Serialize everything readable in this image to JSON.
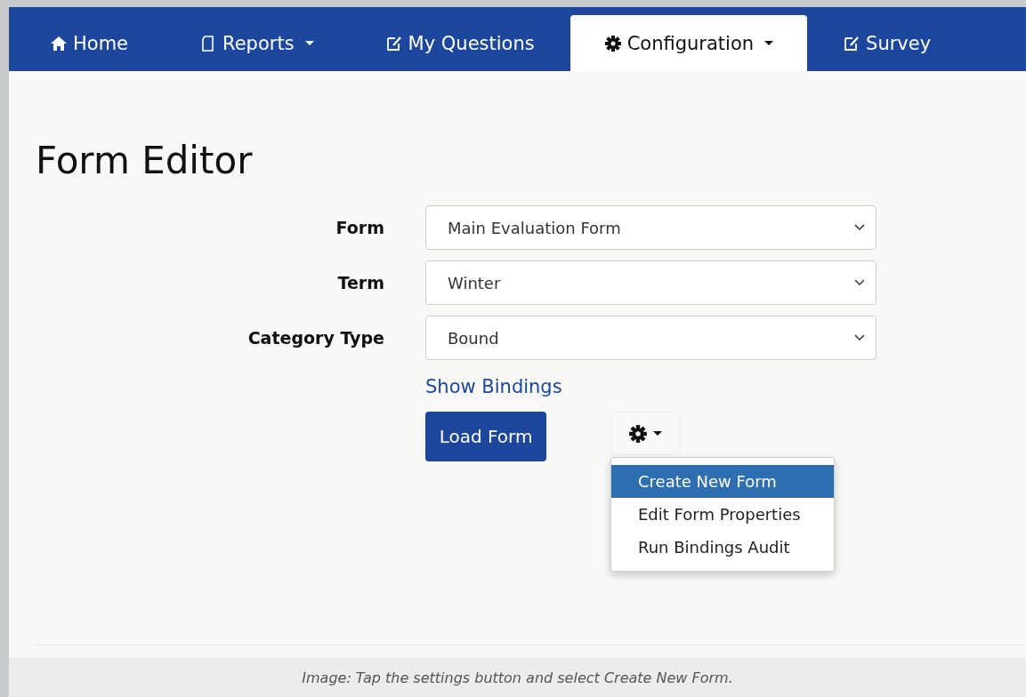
{
  "nav": {
    "tabs": [
      {
        "label": "Home",
        "kind": "home",
        "caret": false,
        "selected": false
      },
      {
        "label": "Reports",
        "kind": "page",
        "caret": true,
        "selected": false
      },
      {
        "label": "My Questions",
        "kind": "edit",
        "caret": false,
        "selected": false
      },
      {
        "label": "Configuration",
        "kind": "gear",
        "caret": true,
        "selected": true
      },
      {
        "label": "Survey",
        "kind": "edit",
        "caret": false,
        "selected": false
      }
    ]
  },
  "page": {
    "title": "Form Editor",
    "fields": [
      {
        "label": "Form",
        "value": "Main Evaluation Form"
      },
      {
        "label": "Term",
        "value": "Winter"
      },
      {
        "label": "Category Type",
        "value": "Bound"
      }
    ],
    "link": "Show Bindings",
    "load_button": "Load Form",
    "settings_menu": {
      "expanded": true,
      "items": [
        {
          "label": "Create New Form",
          "selected": true
        },
        {
          "label": "Edit Form Properties",
          "selected": false
        },
        {
          "label": "Run Bindings Audit",
          "selected": false
        }
      ]
    }
  },
  "caption": "Image: Tap the settings button and select Create New Form."
}
